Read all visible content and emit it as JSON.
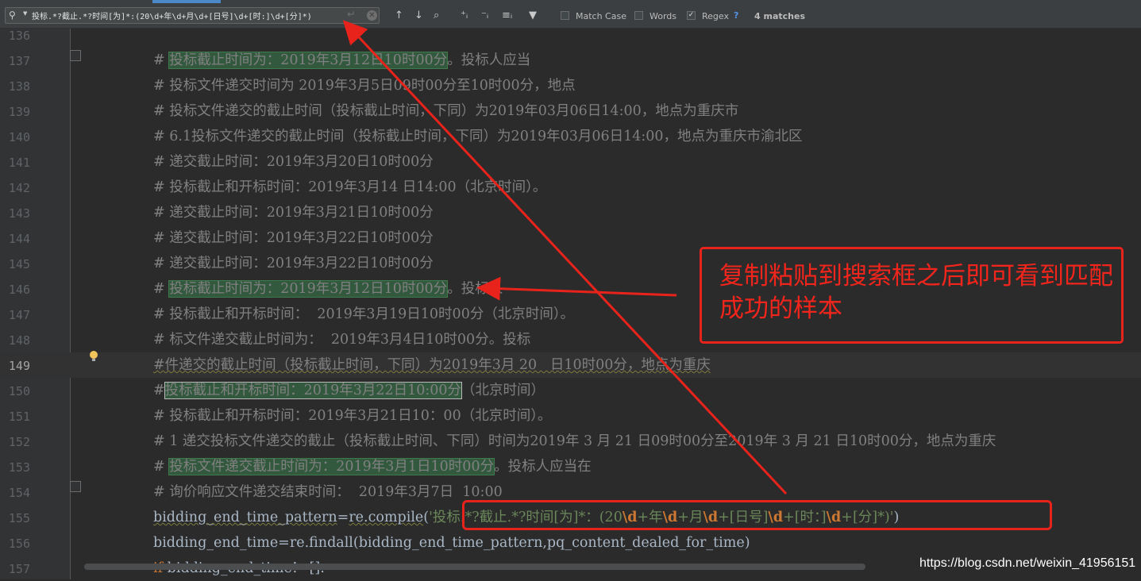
{
  "find_bar": {
    "search_value": "投标.*?截止.*?时间[为]*:(20\\d+年\\d+月\\d+[日号]\\d+[时:]\\d+[分]*)",
    "options": [
      {
        "label": "Match Case",
        "checked": false
      },
      {
        "label": "Words",
        "checked": false
      },
      {
        "label": "Regex",
        "checked": true
      }
    ],
    "help": "?",
    "matches": "4 matches"
  },
  "editor": {
    "line_numbers": [
      "136",
      "137",
      "138",
      "139",
      "140",
      "141",
      "142",
      "143",
      "144",
      "145",
      "146",
      "147",
      "148",
      "149",
      "150",
      "151",
      "152",
      "153",
      "154",
      "155",
      "156",
      "157"
    ],
    "current_line": "149",
    "lines": [
      {
        "pre": "",
        "hl": "",
        "post": ""
      },
      {
        "pre": "# ",
        "hl": "投标截止时间为：2019年3月12日10时00分",
        "post": "。投标人应当"
      },
      {
        "pre": "# 投标文件递交时间为 2019年3月5日09时00分至10时00分，地点",
        "hl": "",
        "post": ""
      },
      {
        "pre": "# 投标文件递交的截止时间（投标截止时间，下同）为2019年03月06日14:00，地点为重庆市",
        "hl": "",
        "post": ""
      },
      {
        "pre": "# 6.1投标文件递交的截止时间（投标截止时间，下同）为2019年03月06日14:00，地点为重庆市渝北区",
        "hl": "",
        "post": ""
      },
      {
        "pre": "# 递交截止时间：2019年3月20日10时00分",
        "hl": "",
        "post": ""
      },
      {
        "pre": "# 投标截止和开标时间：2019年3月14 日14:00（北京时间）。",
        "hl": "",
        "post": ""
      },
      {
        "pre": "# 递交截止时间：2019年3月21日10时00分",
        "hl": "",
        "post": ""
      },
      {
        "pre": "# 递交截止时间：2019年3月22日10时00分",
        "hl": "",
        "post": ""
      },
      {
        "pre": "# 递交截止时间：2019年3月22日10时00分",
        "hl": "",
        "post": ""
      },
      {
        "pre": "# ",
        "hl": "投标截止时间为：2019年3月12日10时00分",
        "post": "。投标人"
      },
      {
        "pre": "# 投标截止和开标时间：  2019年3月19日10时00分（北京时间）。",
        "hl": "",
        "post": ""
      },
      {
        "pre": "# 标文件递交截止时间为：  2019年3月4日10时00分。投标",
        "hl": "",
        "post": ""
      },
      {
        "pre": "#件递交的截止时间（投标截止时间，下同）为2019年3月 20   日10时00分，地点为重庆",
        "hl": "",
        "post": ""
      },
      {
        "pre": "#",
        "hl": "投标截止和开标时间：2019年3月22日10:00分",
        "post": "（北京时间）"
      },
      {
        "pre": "# 投标截止和开标时间：2019年3月21日10：00（北京时间）。",
        "hl": "",
        "post": ""
      },
      {
        "pre": "# 1 递交投标文件递交的截止（投标截止时间、下同）时间为2019年 3 月 21 日09时00分至2019年 3 月 21 日10时00分，地点为重庆",
        "hl": "",
        "post": ""
      },
      {
        "pre": "# ",
        "hl": "投标文件递交截止时间为：2019年3月1日10时00分",
        "post": "。投标人应当在"
      },
      {
        "pre": "# 询价响应文件递交结束时间：  2019年3月7日  10:00",
        "hl": "",
        "post": ""
      }
    ],
    "code_155": {
      "lhs": "bidding_end_time_pattern",
      "eq": "=",
      "call": "re.compile",
      "open": "(",
      "regex_parts": [
        {
          "t": "'投标",
          "c": "s"
        },
        {
          "t": ".*?",
          "c": "s"
        },
        {
          "t": "截止",
          "c": "s"
        },
        {
          "t": ".*?",
          "c": "s"
        },
        {
          "t": "时间[为]*：(20",
          "c": "s"
        },
        {
          "t": "\\d",
          "c": "e"
        },
        {
          "t": "+年",
          "c": "s"
        },
        {
          "t": "\\d",
          "c": "e"
        },
        {
          "t": "+月",
          "c": "s"
        },
        {
          "t": "\\d",
          "c": "e"
        },
        {
          "t": "+[日号]",
          "c": "s"
        },
        {
          "t": "\\d",
          "c": "e"
        },
        {
          "t": "+[时：]",
          "c": "s"
        },
        {
          "t": "\\d",
          "c": "e"
        },
        {
          "t": "+[分]*)'",
          "c": "s"
        }
      ],
      "close": ")"
    },
    "code_156": "bidding_end_time=re.findall(bidding_end_time_pattern,pq_content_dealed_for_time)",
    "code_157_kw": "if",
    "code_157_rest": " bidding_end_time!=[]:"
  },
  "annotation": {
    "text": "复制粘贴到搜索框之后即可看到匹配成功的样本",
    "color": "#e8231b"
  },
  "watermark": "https://blog.csdn.net/weixin_41956151"
}
